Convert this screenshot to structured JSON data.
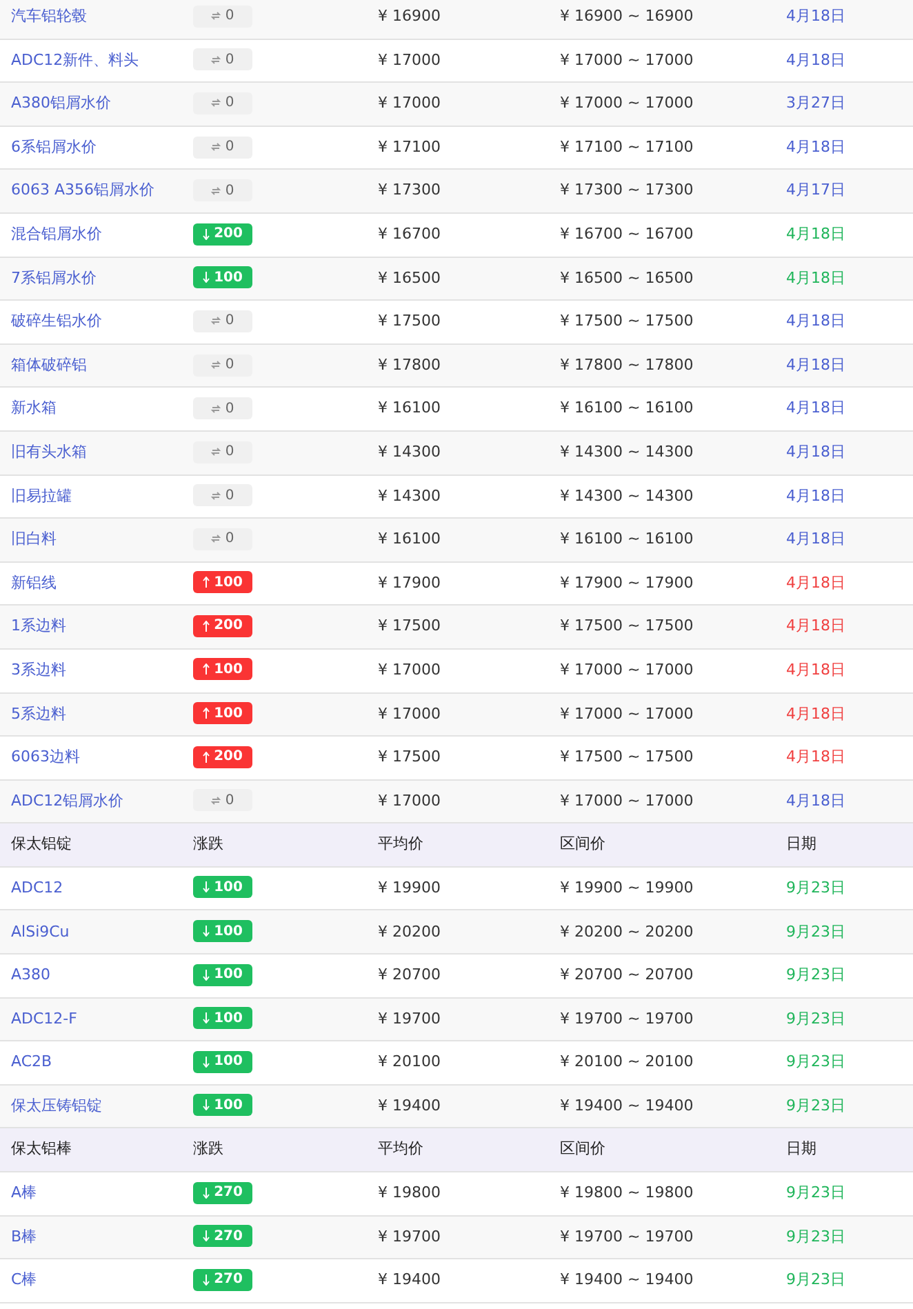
{
  "sections": [
    {
      "rows": [
        {
          "name": "汽车铝轮毂",
          "kind": "flat",
          "change": "0",
          "avg": "¥ 16900",
          "range": "¥ 16900 ~ 16900",
          "date": "4月18日"
        },
        {
          "name": "ADC12新件、料头",
          "kind": "flat",
          "change": "0",
          "avg": "¥ 17000",
          "range": "¥ 17000 ~ 17000",
          "date": "4月18日"
        },
        {
          "name": "A380铝屑水价",
          "kind": "flat",
          "change": "0",
          "avg": "¥ 17000",
          "range": "¥ 17000 ~ 17000",
          "date": "3月27日"
        },
        {
          "name": "6系铝屑水价",
          "kind": "flat",
          "change": "0",
          "avg": "¥ 17100",
          "range": "¥ 17100 ~ 17100",
          "date": "4月18日"
        },
        {
          "name": "6063 A356铝屑水价",
          "kind": "flat",
          "change": "0",
          "avg": "¥ 17300",
          "range": "¥ 17300 ~ 17300",
          "date": "4月17日"
        },
        {
          "name": "混合铝屑水价",
          "kind": "down",
          "change": "200",
          "avg": "¥ 16700",
          "range": "¥ 16700 ~ 16700",
          "date": "4月18日"
        },
        {
          "name": "7系铝屑水价",
          "kind": "down",
          "change": "100",
          "avg": "¥ 16500",
          "range": "¥ 16500 ~ 16500",
          "date": "4月18日"
        },
        {
          "name": "破碎生铝水价",
          "kind": "flat",
          "change": "0",
          "avg": "¥ 17500",
          "range": "¥ 17500 ~ 17500",
          "date": "4月18日"
        },
        {
          "name": "箱体破碎铝",
          "kind": "flat",
          "change": "0",
          "avg": "¥ 17800",
          "range": "¥ 17800 ~ 17800",
          "date": "4月18日"
        },
        {
          "name": "新水箱",
          "kind": "flat",
          "change": "0",
          "avg": "¥ 16100",
          "range": "¥ 16100 ~ 16100",
          "date": "4月18日"
        },
        {
          "name": "旧有头水箱",
          "kind": "flat",
          "change": "0",
          "avg": "¥ 14300",
          "range": "¥ 14300 ~ 14300",
          "date": "4月18日"
        },
        {
          "name": "旧易拉罐",
          "kind": "flat",
          "change": "0",
          "avg": "¥ 14300",
          "range": "¥ 14300 ~ 14300",
          "date": "4月18日"
        },
        {
          "name": "旧白料",
          "kind": "flat",
          "change": "0",
          "avg": "¥ 16100",
          "range": "¥ 16100 ~ 16100",
          "date": "4月18日"
        },
        {
          "name": "新铝线",
          "kind": "up",
          "change": "100",
          "avg": "¥ 17900",
          "range": "¥ 17900 ~ 17900",
          "date": "4月18日"
        },
        {
          "name": "1系边料",
          "kind": "up",
          "change": "200",
          "avg": "¥ 17500",
          "range": "¥ 17500 ~ 17500",
          "date": "4月18日"
        },
        {
          "name": "3系边料",
          "kind": "up",
          "change": "100",
          "avg": "¥ 17000",
          "range": "¥ 17000 ~ 17000",
          "date": "4月18日"
        },
        {
          "name": "5系边料",
          "kind": "up",
          "change": "100",
          "avg": "¥ 17000",
          "range": "¥ 17000 ~ 17000",
          "date": "4月18日"
        },
        {
          "name": "6063边料",
          "kind": "up",
          "change": "200",
          "avg": "¥ 17500",
          "range": "¥ 17500 ~ 17500",
          "date": "4月18日"
        },
        {
          "name": "ADC12铝屑水价",
          "kind": "flat",
          "change": "0",
          "avg": "¥ 17000",
          "range": "¥ 17000 ~ 17000",
          "date": "4月18日"
        }
      ]
    },
    {
      "columns": [
        "保太铝锭",
        "涨跌",
        "平均价",
        "区间价",
        "日期"
      ],
      "rows": [
        {
          "name": "ADC12",
          "kind": "down",
          "change": "100",
          "avg": "¥ 19900",
          "range": "¥ 19900 ~ 19900",
          "date": "9月23日"
        },
        {
          "name": "AlSi9Cu",
          "kind": "down",
          "change": "100",
          "avg": "¥ 20200",
          "range": "¥ 20200 ~ 20200",
          "date": "9月23日"
        },
        {
          "name": "A380",
          "kind": "down",
          "change": "100",
          "avg": "¥ 20700",
          "range": "¥ 20700 ~ 20700",
          "date": "9月23日"
        },
        {
          "name": "ADC12-F",
          "kind": "down",
          "change": "100",
          "avg": "¥ 19700",
          "range": "¥ 19700 ~ 19700",
          "date": "9月23日"
        },
        {
          "name": "AC2B",
          "kind": "down",
          "change": "100",
          "avg": "¥ 20100",
          "range": "¥ 20100 ~ 20100",
          "date": "9月23日"
        },
        {
          "name": "保太压铸铝锭",
          "kind": "down",
          "change": "100",
          "avg": "¥ 19400",
          "range": "¥ 19400 ~ 19400",
          "date": "9月23日"
        }
      ]
    },
    {
      "columns": [
        "保太铝棒",
        "涨跌",
        "平均价",
        "区间价",
        "日期"
      ],
      "rows": [
        {
          "name": "A棒",
          "kind": "down",
          "change": "270",
          "avg": "¥ 19800",
          "range": "¥ 19800 ~ 19800",
          "date": "9月23日"
        },
        {
          "name": "B棒",
          "kind": "down",
          "change": "270",
          "avg": "¥ 19700",
          "range": "¥ 19700 ~ 19700",
          "date": "9月23日"
        },
        {
          "name": "C棒",
          "kind": "down",
          "change": "270",
          "avg": "¥ 19400",
          "range": "¥ 19400 ~ 19400",
          "date": "9月23日"
        }
      ]
    }
  ]
}
